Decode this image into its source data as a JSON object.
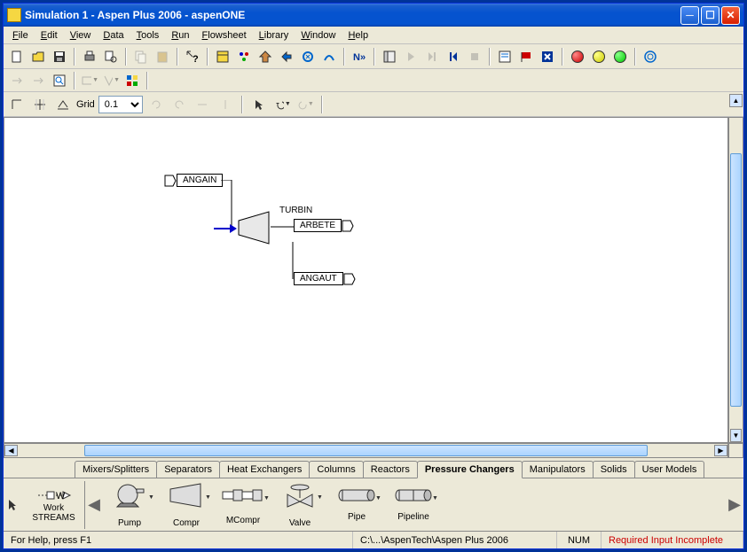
{
  "titlebar": {
    "title": "Simulation 1 - Aspen Plus 2006 - aspenONE"
  },
  "menu": {
    "file": "File",
    "edit": "Edit",
    "view": "View",
    "data": "Data",
    "tools": "Tools",
    "run": "Run",
    "flowsheet": "Flowsheet",
    "library": "Library",
    "window": "Window",
    "help": "Help"
  },
  "grid": {
    "label": "Grid",
    "value": "0.1"
  },
  "flowsheet": {
    "stream_in": "ANGAIN",
    "stream_out": "ANGAUT",
    "block_name": "TURBIN",
    "work_stream": "ARBETE"
  },
  "palette": {
    "streams_side": {
      "work": "Work",
      "streams": "STREAMS"
    },
    "arrow_cursor": "↖",
    "tabs": {
      "mixers": "Mixers/Splitters",
      "separators": "Separators",
      "heatex": "Heat Exchangers",
      "columns": "Columns",
      "reactors": "Reactors",
      "pressure": "Pressure Changers",
      "manipulators": "Manipulators",
      "solids": "Solids",
      "usermodels": "User Models"
    },
    "items": {
      "pump": "Pump",
      "compr": "Compr",
      "mcompr": "MCompr",
      "valve": "Valve",
      "pipe": "Pipe",
      "pipeline": "Pipeline"
    }
  },
  "status": {
    "help": "For Help, press F1",
    "path": "C:\\...\\AspenTech\\Aspen Plus 2006",
    "num": "NUM",
    "input": "Required Input Incomplete"
  }
}
